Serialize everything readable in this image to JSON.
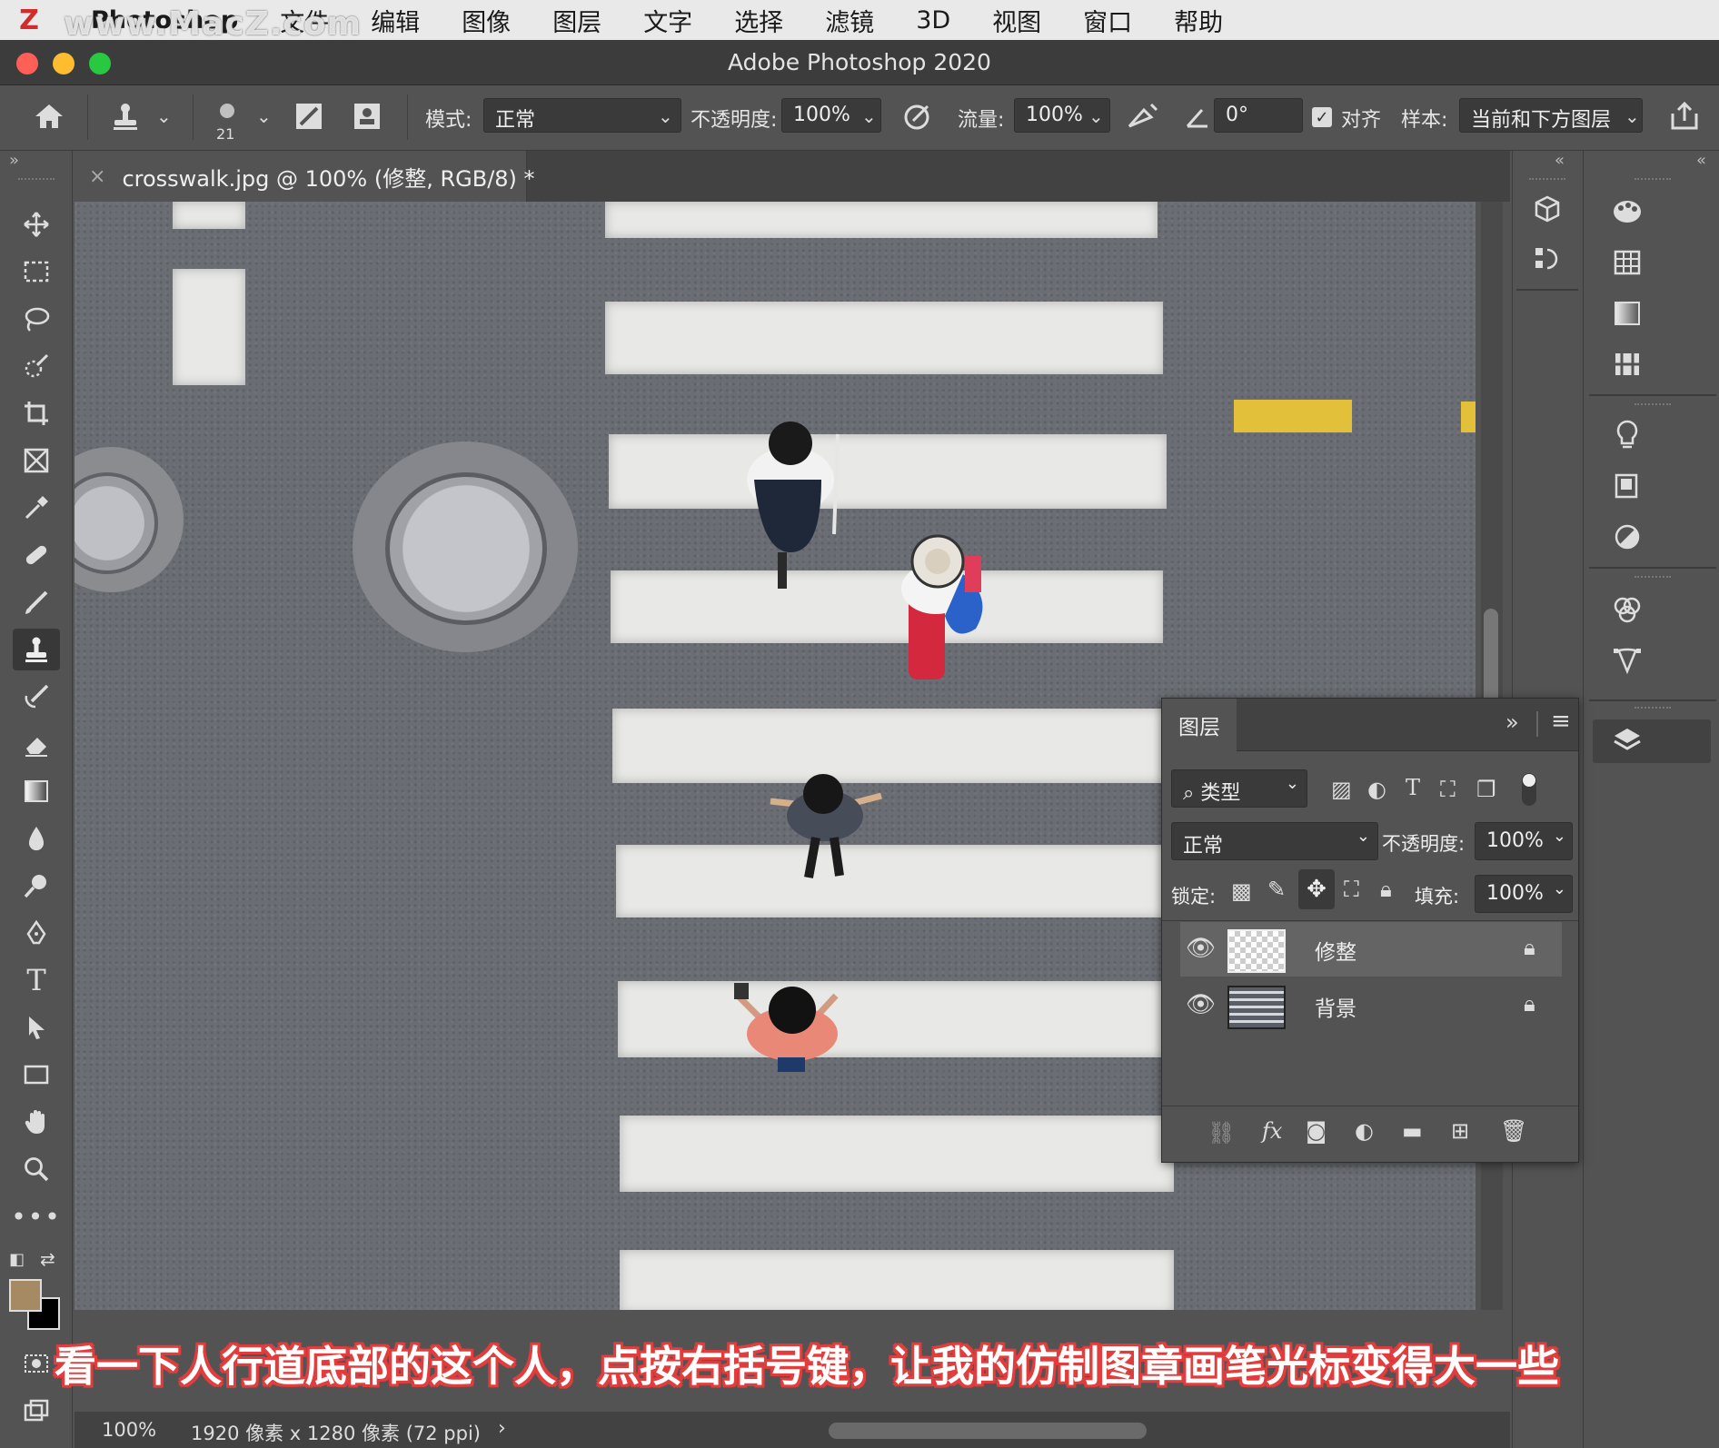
{
  "menubar": {
    "app": "Photoshop",
    "items": [
      "文件",
      "编辑",
      "图像",
      "图层",
      "文字",
      "选择",
      "滤镜",
      "3D",
      "视图",
      "窗口",
      "帮助"
    ]
  },
  "watermark": "www.MacZ.com",
  "window": {
    "title": "Adobe Photoshop 2020"
  },
  "options": {
    "brush_size": "21",
    "mode_label": "模式:",
    "mode_value": "正常",
    "opacity_label": "不透明度:",
    "opacity_value": "100%",
    "flow_label": "流量:",
    "flow_value": "100%",
    "angle_value": "0°",
    "aligned_label": "对齐",
    "aligned_checked": true,
    "sample_label": "样本:",
    "sample_value": "当前和下方图层"
  },
  "document": {
    "tab_title": "crosswalk.jpg @ 100% (修整, RGB/8) *"
  },
  "layers_panel": {
    "tab": "图层",
    "filter_type": "类型",
    "blend_mode": "正常",
    "opacity_label": "不透明度:",
    "opacity_value": "100%",
    "lock_label": "锁定:",
    "fill_label": "填充:",
    "fill_value": "100%",
    "layers": [
      {
        "name": "修整",
        "visible": true,
        "selected": true
      },
      {
        "name": "背景",
        "visible": true,
        "selected": false
      }
    ]
  },
  "subtitle": "看一下人行道底部的这个人，点按右括号键，让我的仿制图章画笔光标变得大一些",
  "status": {
    "zoom": "100%",
    "doc_info": "1920 像素 x 1280 像素 (72 ppi)"
  },
  "colors": {
    "foreground": "#a58a64",
    "background": "#000000",
    "subtitle_outline": "#e23c3c"
  }
}
